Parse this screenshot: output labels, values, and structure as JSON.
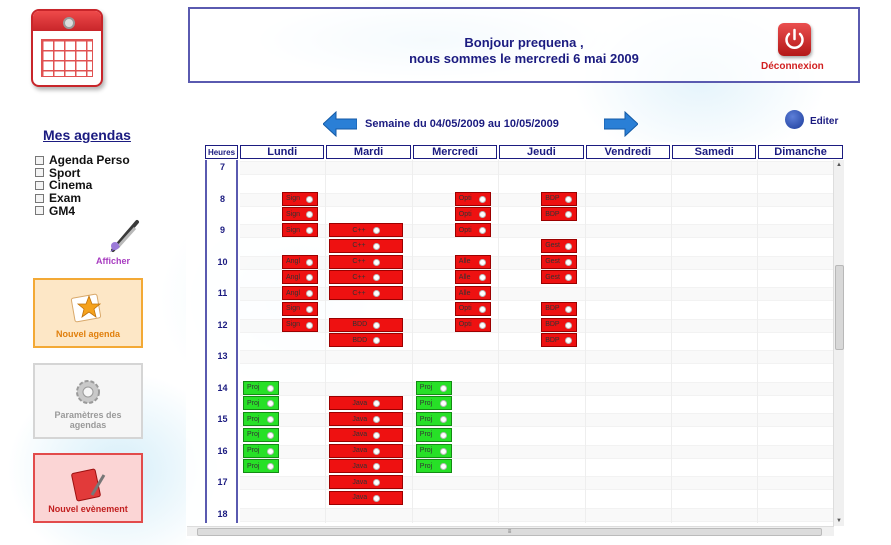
{
  "header": {
    "greeting_line1": "Bonjour prequena ,",
    "greeting_line2": "nous sommes le mercredi 6 mai 2009",
    "logout_label": "Déconnexion"
  },
  "sidebar": {
    "title": "Mes agendas",
    "agendas": [
      "Agenda Perso",
      "Sport",
      "Cinema",
      "Exam",
      "GM4"
    ],
    "afficher_label": "Afficher",
    "buttons": {
      "nouvel_agenda": "Nouvel agenda",
      "parametres": "Paramètres des agendas",
      "nouvel_evenement": "Nouvel evènement"
    }
  },
  "week_nav": {
    "label": "Semaine du 04/05/2009 au 10/05/2009",
    "editer_label": "Editer"
  },
  "calendar": {
    "hours_header": "Heures",
    "days": [
      "Lundi",
      "Mardi",
      "Mercredi",
      "Jeudi",
      "Vendredi",
      "Samedi",
      "Dimanche"
    ],
    "hours": [
      "7",
      "8",
      "9",
      "10",
      "11",
      "12",
      "13",
      "14",
      "15",
      "16",
      "17",
      "18"
    ],
    "events": [
      {
        "day": 0,
        "slot": 2,
        "label": "Sign",
        "color": "#ee1111"
      },
      {
        "day": 0,
        "slot": 3,
        "label": "Sign",
        "color": "#ee1111"
      },
      {
        "day": 0,
        "slot": 4,
        "label": "Sign",
        "color": "#ee1111"
      },
      {
        "day": 0,
        "slot": 6,
        "label": "Angl",
        "color": "#ee1111"
      },
      {
        "day": 0,
        "slot": 7,
        "label": "Angl",
        "color": "#ee1111"
      },
      {
        "day": 0,
        "slot": 8,
        "label": "Angl",
        "color": "#ee1111"
      },
      {
        "day": 0,
        "slot": 9,
        "label": "Sign",
        "color": "#ee1111"
      },
      {
        "day": 0,
        "slot": 10,
        "label": "Sign",
        "color": "#ee1111"
      },
      {
        "day": 0,
        "slot": 14,
        "label": "Proj",
        "color": "#27e027"
      },
      {
        "day": 0,
        "slot": 15,
        "label": "Proj",
        "color": "#27e027"
      },
      {
        "day": 0,
        "slot": 16,
        "label": "Proj",
        "color": "#27e027"
      },
      {
        "day": 0,
        "slot": 17,
        "label": "Proj",
        "color": "#27e027"
      },
      {
        "day": 0,
        "slot": 18,
        "label": "Proj",
        "color": "#27e027"
      },
      {
        "day": 0,
        "slot": 19,
        "label": "Proj",
        "color": "#27e027"
      },
      {
        "day": 1,
        "slot": 4,
        "label": "C++",
        "color": "#ee1111"
      },
      {
        "day": 1,
        "slot": 5,
        "label": "C++",
        "color": "#ee1111"
      },
      {
        "day": 1,
        "slot": 6,
        "label": "C++",
        "color": "#ee1111"
      },
      {
        "day": 1,
        "slot": 7,
        "label": "C++",
        "color": "#ee1111"
      },
      {
        "day": 1,
        "slot": 8,
        "label": "C++",
        "color": "#ee1111"
      },
      {
        "day": 1,
        "slot": 10,
        "label": "BDD",
        "color": "#ee1111"
      },
      {
        "day": 1,
        "slot": 11,
        "label": "BDD",
        "color": "#ee1111"
      },
      {
        "day": 1,
        "slot": 15,
        "label": "Java",
        "color": "#ee1111"
      },
      {
        "day": 1,
        "slot": 16,
        "label": "Java",
        "color": "#ee1111"
      },
      {
        "day": 1,
        "slot": 17,
        "label": "Java",
        "color": "#ee1111"
      },
      {
        "day": 1,
        "slot": 18,
        "label": "Java",
        "color": "#ee1111"
      },
      {
        "day": 1,
        "slot": 19,
        "label": "Java",
        "color": "#ee1111"
      },
      {
        "day": 1,
        "slot": 20,
        "label": "Java",
        "color": "#ee1111"
      },
      {
        "day": 1,
        "slot": 21,
        "label": "Java",
        "color": "#ee1111"
      },
      {
        "day": 2,
        "slot": 2,
        "label": "Opti",
        "color": "#ee1111"
      },
      {
        "day": 2,
        "slot": 3,
        "label": "Opti",
        "color": "#ee1111"
      },
      {
        "day": 2,
        "slot": 4,
        "label": "Opti",
        "color": "#ee1111"
      },
      {
        "day": 2,
        "slot": 6,
        "label": "Alle",
        "color": "#ee1111"
      },
      {
        "day": 2,
        "slot": 7,
        "label": "Alle",
        "color": "#ee1111"
      },
      {
        "day": 2,
        "slot": 8,
        "label": "Alle",
        "color": "#ee1111"
      },
      {
        "day": 2,
        "slot": 9,
        "label": "Opti",
        "color": "#ee1111"
      },
      {
        "day": 2,
        "slot": 10,
        "label": "Opti",
        "color": "#ee1111"
      },
      {
        "day": 2,
        "slot": 14,
        "label": "Proj",
        "color": "#27e027"
      },
      {
        "day": 2,
        "slot": 15,
        "label": "Proj",
        "color": "#27e027"
      },
      {
        "day": 2,
        "slot": 16,
        "label": "Proj",
        "color": "#27e027"
      },
      {
        "day": 2,
        "slot": 17,
        "label": "Proj",
        "color": "#27e027"
      },
      {
        "day": 2,
        "slot": 18,
        "label": "Proj",
        "color": "#27e027"
      },
      {
        "day": 2,
        "slot": 19,
        "label": "Proj",
        "color": "#27e027"
      },
      {
        "day": 3,
        "slot": 2,
        "label": "BDP",
        "color": "#ee1111"
      },
      {
        "day": 3,
        "slot": 3,
        "label": "BDP",
        "color": "#ee1111"
      },
      {
        "day": 3,
        "slot": 5,
        "label": "Gest",
        "color": "#ee1111"
      },
      {
        "day": 3,
        "slot": 6,
        "label": "Gest",
        "color": "#ee1111"
      },
      {
        "day": 3,
        "slot": 7,
        "label": "Gest",
        "color": "#ee1111"
      },
      {
        "day": 3,
        "slot": 9,
        "label": "BDP",
        "color": "#ee1111"
      },
      {
        "day": 3,
        "slot": 10,
        "label": "BDP",
        "color": "#ee1111"
      },
      {
        "day": 3,
        "slot": 11,
        "label": "BDP",
        "color": "#ee1111"
      }
    ]
  },
  "colors": {
    "navy": "#1b1b80",
    "event_red": "#ee1111",
    "event_green": "#27e027",
    "logout_red": "#d12020"
  }
}
